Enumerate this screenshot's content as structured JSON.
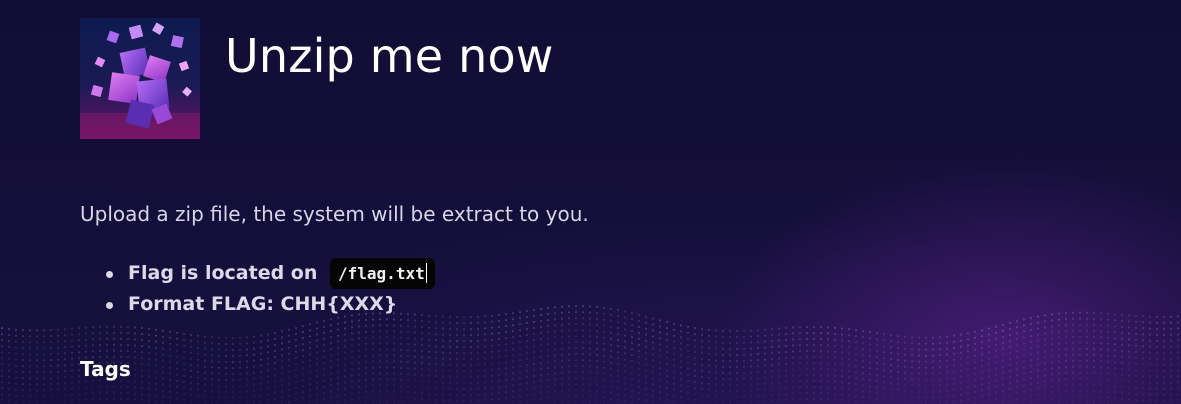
{
  "challenge": {
    "title": "Unzip me now",
    "thumbnail_icon": "purple-cubes-icon",
    "description": "Upload a zip file, the system will be extract to you.",
    "bullets": [
      {
        "text": "Flag is located on",
        "code": "/flag.txt"
      },
      {
        "text": "Format FLAG: CHH{XXX}"
      }
    ],
    "tags_heading": "Tags"
  },
  "colors": {
    "background": "#130e37",
    "accent_glow": "#7828aa",
    "text": "#ffffff",
    "muted_text": "#d7d5e6",
    "code_background": "#050505"
  }
}
